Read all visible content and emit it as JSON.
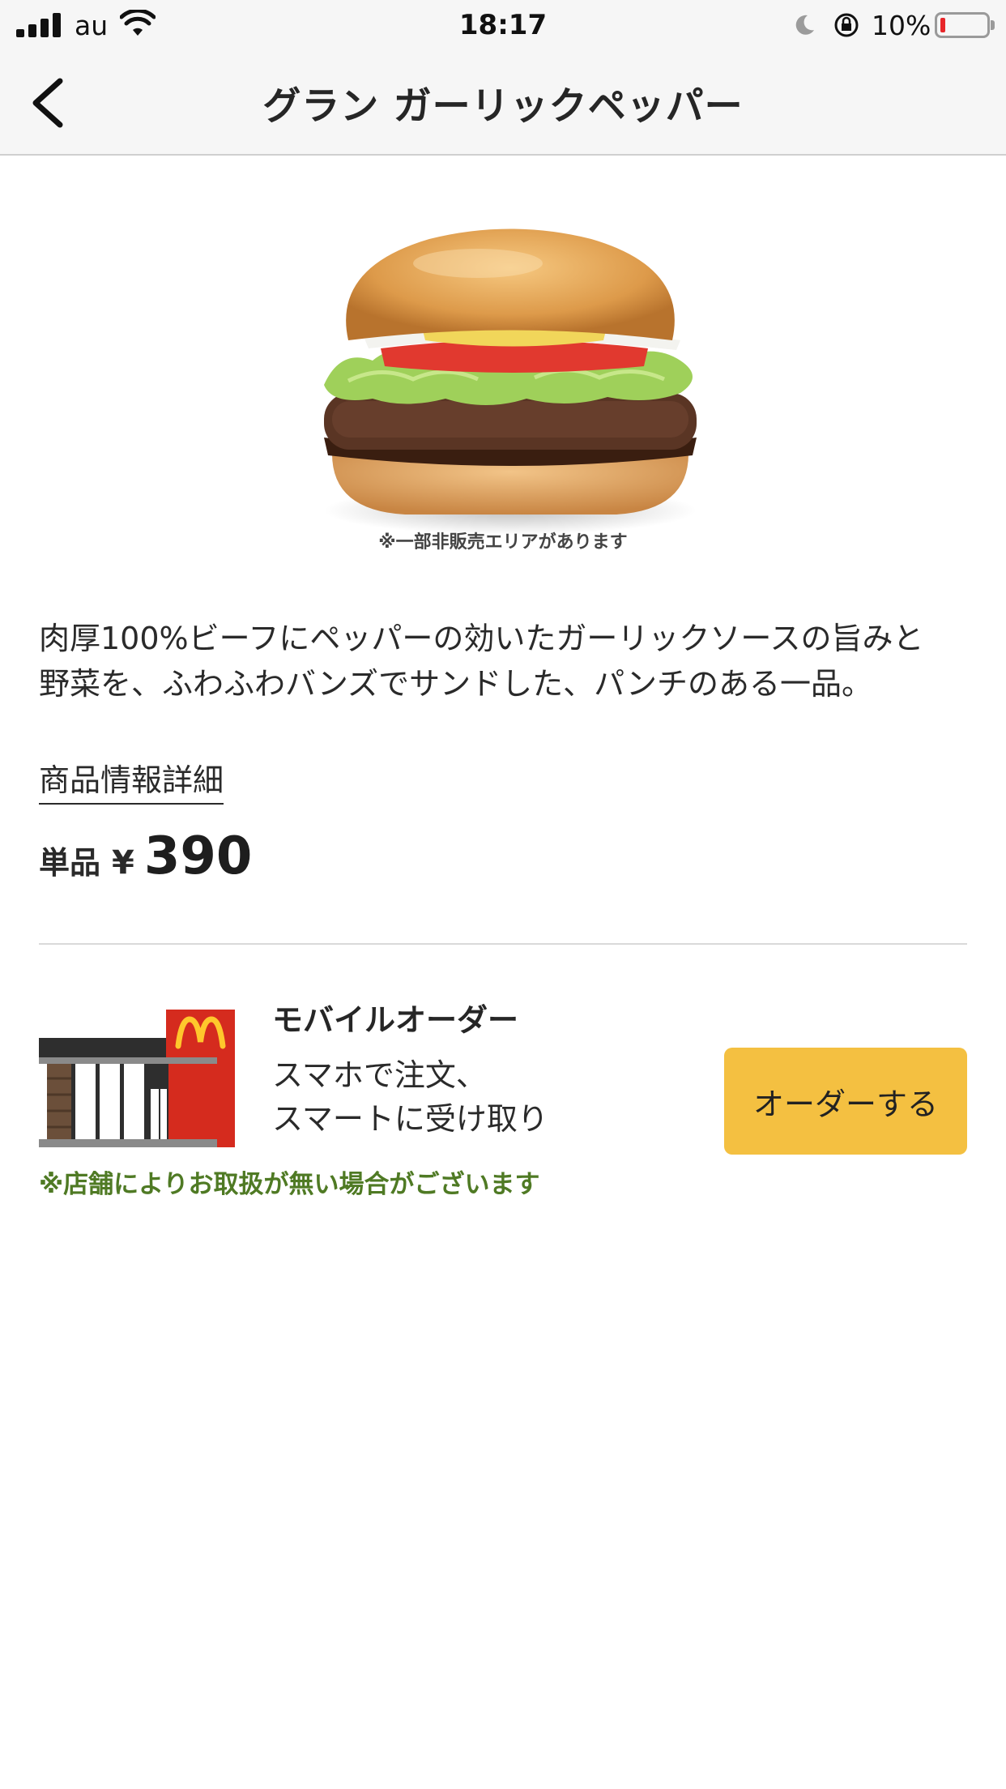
{
  "status_bar": {
    "carrier": "au",
    "time": "18:17",
    "battery_percent": "10%",
    "battery_level": 0.1,
    "icons": [
      "signal-icon",
      "wifi-icon",
      "moon-icon",
      "rotation-lock-icon",
      "battery-icon"
    ]
  },
  "nav": {
    "title": "グラン ガーリックペッパー",
    "back_icon": "chevron-left-icon"
  },
  "product": {
    "image_note": "※一部非販売エリアがあります",
    "description_line1": "肉厚100%ビーフにペッパーの効いたガーリックソースの旨みと",
    "description_line2": "野菜を、ふわふわバンズでサンドした、パンチのある一品。",
    "detail_link": "商品情報詳細",
    "price_label": "単品",
    "price_currency": "¥",
    "price_value": "390"
  },
  "mobile_order": {
    "title": "モバイルオーダー",
    "desc_line1": "スマホで注文、",
    "desc_line2": "スマートに受け取り",
    "button_label": "オーダーする",
    "note": "※店舗によりお取扱が無い場合がございます",
    "icon": "store-icon"
  },
  "colors": {
    "button": "#f4c041",
    "note_green": "#4f7a24",
    "logo_red": "#d52b1e",
    "logo_yellow": "#ffc72c"
  }
}
